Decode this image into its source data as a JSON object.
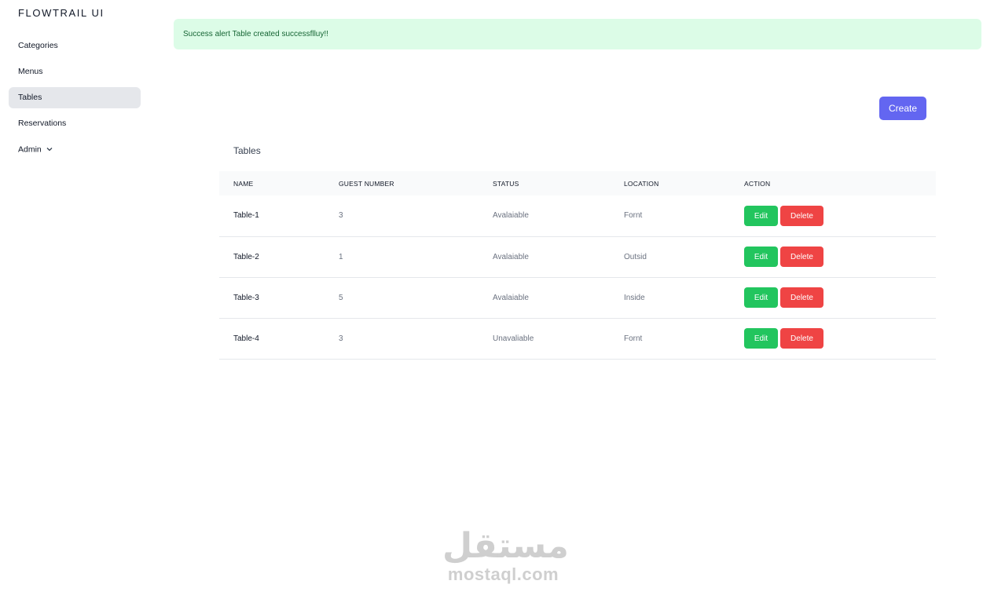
{
  "brand": "FLOWTRAIL UI",
  "sidebar": {
    "items": [
      {
        "label": "Categories",
        "active": false
      },
      {
        "label": "Menus",
        "active": false
      },
      {
        "label": "Tables",
        "active": true
      },
      {
        "label": "Reservations",
        "active": false
      },
      {
        "label": "Admin",
        "active": false,
        "icon": "chevron-down-icon"
      }
    ]
  },
  "alert": {
    "prefix": "Success alert",
    "message": "Table created successflluy!!",
    "color": "#dcfce7"
  },
  "create_button": {
    "label": "Create",
    "color": "#6366f1"
  },
  "card_title": "Tables",
  "table": {
    "columns": [
      "NAME",
      "GUEST NUMBER",
      "STATUS",
      "LOCATION",
      "ACTION"
    ],
    "rows": [
      {
        "name": "Table-1",
        "guests": "3",
        "status": "Avalaiable",
        "location": "Fornt"
      },
      {
        "name": "Table-2",
        "guests": "1",
        "status": "Avalaiable",
        "location": "Outsid"
      },
      {
        "name": "Table-3",
        "guests": "5",
        "status": "Avalaiable",
        "location": "Inside"
      },
      {
        "name": "Table-4",
        "guests": "3",
        "status": "Unavaliable",
        "location": "Fornt"
      }
    ],
    "edit_label": "Edit",
    "delete_label": "Delete",
    "edit_color": "#22c55e",
    "delete_color": "#ef4444"
  },
  "watermark": {
    "arabic": "مستقل",
    "latin": "mostaql.com"
  }
}
